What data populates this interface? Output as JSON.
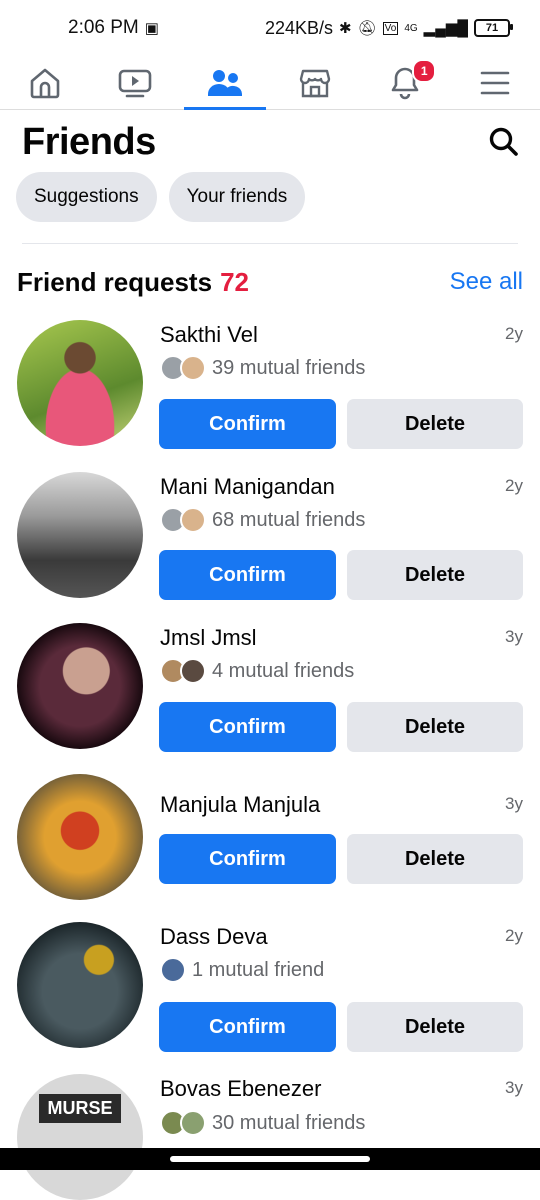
{
  "status_bar": {
    "time": "2:06 PM",
    "network_speed": "224KB/s",
    "network_type": "4G",
    "battery": "71"
  },
  "nav": {
    "items": [
      {
        "icon": "home-icon"
      },
      {
        "icon": "video-icon"
      },
      {
        "icon": "friends-icon",
        "active": true
      },
      {
        "icon": "marketplace-icon"
      },
      {
        "icon": "bell-icon",
        "badge": "1"
      },
      {
        "icon": "menu-icon"
      }
    ]
  },
  "page": {
    "title": "Friends"
  },
  "chips": {
    "suggestions": "Suggestions",
    "your_friends": "Your friends"
  },
  "requests_section": {
    "title": "Friend requests",
    "count": "72",
    "see_all": "See all"
  },
  "requests": [
    {
      "name": "Sakthi Vel",
      "time": "2y",
      "mutual": "39 mutual friends",
      "confirm": "Confirm",
      "delete": "Delete"
    },
    {
      "name": "Mani Manigandan",
      "time": "2y",
      "mutual": "68 mutual friends",
      "confirm": "Confirm",
      "delete": "Delete"
    },
    {
      "name": "Jmsl Jmsl",
      "time": "3y",
      "mutual": "4 mutual friends",
      "confirm": "Confirm",
      "delete": "Delete"
    },
    {
      "name": "Manjula Manjula",
      "time": "3y",
      "mutual": "",
      "confirm": "Confirm",
      "delete": "Delete"
    },
    {
      "name": "Dass Deva",
      "time": "2y",
      "mutual": "1 mutual friend",
      "confirm": "Confirm",
      "delete": "Delete"
    },
    {
      "name": "Bovas Ebenezer",
      "time": "3y",
      "mutual": "30 mutual friends"
    }
  ],
  "avatar_text": {
    "bovas": "MURSE"
  },
  "colors": {
    "accent": "#1877f2",
    "badge": "#e41e3f",
    "chip_bg": "#e4e6eb"
  }
}
